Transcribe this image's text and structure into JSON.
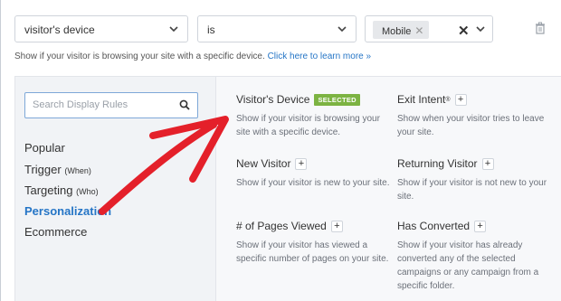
{
  "rule": {
    "field": "visitor's device",
    "operator": "is",
    "value_tag": "Mobile",
    "help_text": "Show if your visitor is browsing your site with a specific device.",
    "help_link": "Click here to learn more »"
  },
  "sidebar": {
    "search_placeholder": "Search Display Rules",
    "items": [
      {
        "label": "Popular",
        "sub": ""
      },
      {
        "label": "Trigger",
        "sub": "(When)"
      },
      {
        "label": "Targeting",
        "sub": "(Who)"
      },
      {
        "label": "Personalization",
        "sub": ""
      },
      {
        "label": "Ecommerce",
        "sub": ""
      }
    ]
  },
  "options": [
    {
      "title": "Visitor's Device",
      "badge": "SELECTED",
      "desc": "Show if your visitor is browsing your site with a specific device."
    },
    {
      "title": "Exit Intent",
      "sup": "®",
      "desc": "Show when your visitor tries to leave your site."
    },
    {
      "title": "New Visitor",
      "desc": "Show if your visitor is new to your site."
    },
    {
      "title": "Returning Visitor",
      "desc": "Show if your visitor is not new to your site."
    },
    {
      "title": "# of Pages Viewed",
      "desc": "Show if your visitor has viewed a specific number of pages on your site."
    },
    {
      "title": "Has Converted",
      "desc": "Show if your visitor has already converted any of the selected campaigns or any campaign from a specific folder."
    }
  ],
  "colors": {
    "accent": "#2575c6",
    "badge": "#7cb342",
    "arrow": "#e4202a"
  }
}
